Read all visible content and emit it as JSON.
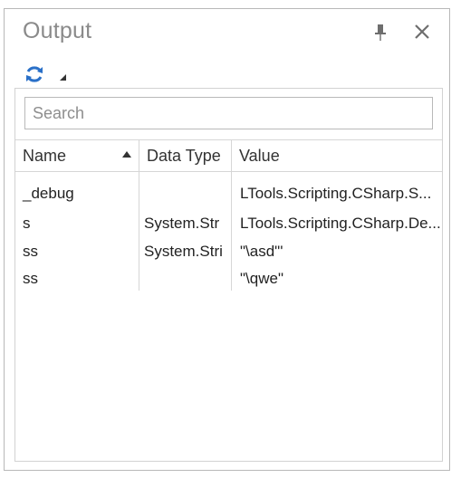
{
  "panel": {
    "title": "Output"
  },
  "toolbar": {
    "refresh_icon": "refresh-icon",
    "dropdown_icon": "triangle-dropdown-icon",
    "accent_color": "#2a70c8"
  },
  "search": {
    "placeholder": "Search",
    "value": ""
  },
  "table": {
    "columns": [
      {
        "label": "Name",
        "sort": "ascending"
      },
      {
        "label": "Data Type"
      },
      {
        "label": "Value"
      }
    ],
    "rows": [
      {
        "name": "_debug",
        "type": "",
        "value": "LTools.Scripting.CSharp.S..."
      },
      {
        "name": "s",
        "type": "System.Str",
        "value": "LTools.Scripting.CSharp.De..."
      },
      {
        "name": "ss",
        "type": "System.Stri",
        "value": "\"\\asd\"'"
      },
      {
        "name": "ss",
        "type": "",
        "value": "\"\\qwe\""
      }
    ]
  }
}
